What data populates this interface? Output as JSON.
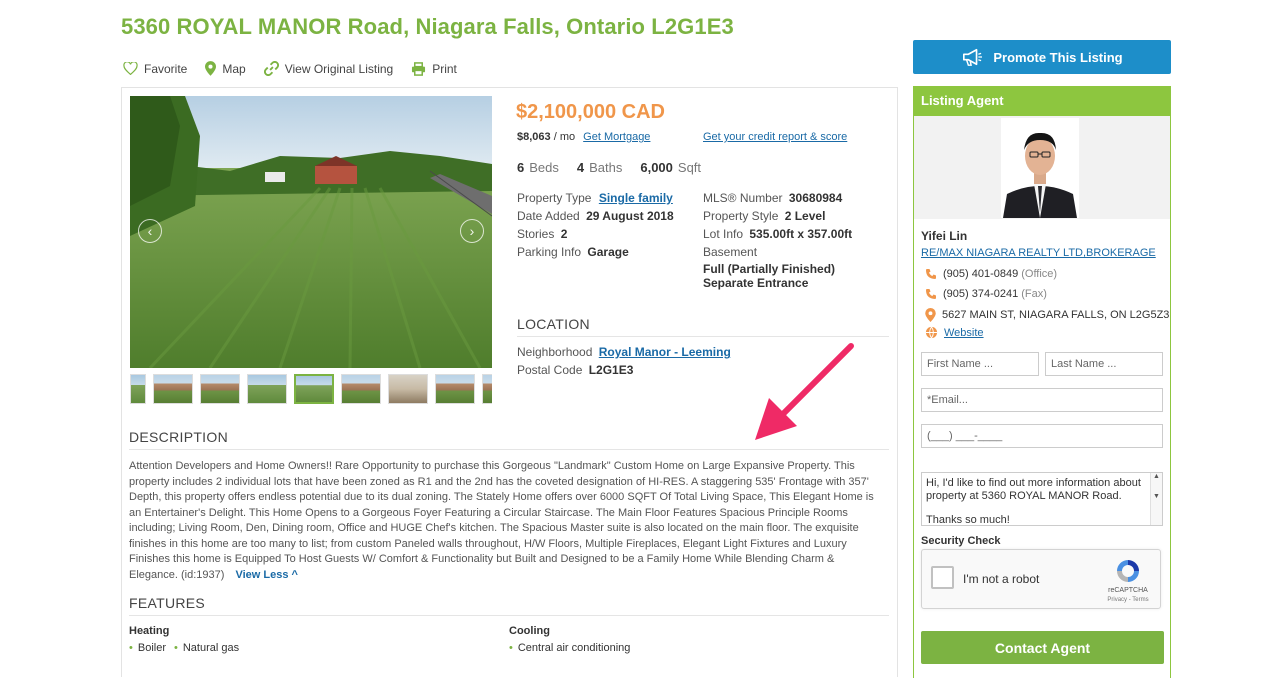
{
  "listing": {
    "title": "5360 ROYAL MANOR Road, Niagara Falls, Ontario L2G1E3"
  },
  "actions": {
    "favorite": "Favorite",
    "map": "Map",
    "view_original": "View Original Listing",
    "print": "Print"
  },
  "price": {
    "amount": "$2,100,000 CAD",
    "monthly": "$8,063",
    "per_mo": " / mo",
    "get_mortgage": "Get Mortgage",
    "credit_link": "Get your credit report & score"
  },
  "summary": {
    "beds_n": "6",
    "beds_label": "Beds",
    "baths_n": "4",
    "baths_label": "Baths",
    "sqft_n": "6,000",
    "sqft_label": "Sqft"
  },
  "details": {
    "property_type_label": "Property Type",
    "property_type": "Single family",
    "date_added_label": "Date Added",
    "date_added": "29 August 2018",
    "stories_label": "Stories",
    "stories": "2",
    "parking_label": "Parking Info",
    "parking": "Garage",
    "mls_label": "MLS® Number",
    "mls": "30680984",
    "style_label": "Property Style",
    "style": "2 Level",
    "lot_label": "Lot Info",
    "lot": "535.00ft x 357.00ft",
    "basement_label": "Basement",
    "basement": "Full (Partially Finished) Separate Entrance"
  },
  "location": {
    "heading": "LOCATION",
    "neighborhood_label": "Neighborhood",
    "neighborhood": "Royal Manor - Leeming",
    "postal_label": "Postal Code",
    "postal": "L2G1E3"
  },
  "description": {
    "heading": "DESCRIPTION",
    "text": "Attention Developers and Home Owners!! Rare Opportunity to purchase this Gorgeous \"Landmark\" Custom Home on Large Expansive Property. This property includes 2 individual lots that have been zoned as R1 and the 2nd has the coveted designation of HI-RES. A staggering 535' Frontage with 357' Depth, this property offers endless potential due to its dual zoning. The Stately Home offers over 6000 SQFT Of Total Living Space, This Elegant Home is an Entertainer's Delight. This Home Opens to a Gorgeous Foyer Featuring a Circular Staircase. The Main Floor Features Spacious Principle Rooms including; Living Room, Den, Dining room, Office and HUGE Chef's kitchen. The Spacious Master suite is also located on the main floor. The exquisite finishes in this home are too many to list; from custom Paneled walls throughout, H/W Floors, Multiple Fireplaces, Elegant Light Fixtures and Luxury Finishes this home is Equipped To Host Guests W/ Comfort & Functionality but Built and Designed to be a Family Home While Blending Charm & Elegance. (id:1937)",
    "view_less": "View Less ^"
  },
  "features": {
    "heading": "FEATURES",
    "heating_label": "Heating",
    "heating": [
      "Boiler",
      "Natural gas"
    ],
    "cooling_label": "Cooling",
    "cooling": [
      "Central air conditioning"
    ]
  },
  "sidebar": {
    "promote": "Promote This Listing",
    "agent_heading": "Listing Agent",
    "agent_name": "Yifei Lin",
    "brokerage": "RE/MAX NIAGARA REALTY LTD,BROKERAGE",
    "office_phone": "(905) 401-0849",
    "office_tag": "(Office)",
    "fax_phone": "(905) 374-0241",
    "fax_tag": "(Fax)",
    "address": "5627 MAIN ST, NIAGARA FALLS, ON L2G5Z3",
    "website": "Website"
  },
  "form": {
    "first_name": "First Name ...",
    "last_name": "Last Name ...",
    "email": "*Email...",
    "phone": "(___) ___-____",
    "message_1": "Hi, I'd like to find out more information about property at 5360 ROYAL MANOR Road.",
    "message_2": "Thanks so much!",
    "security_label": "Security Check",
    "recaptcha_label": "I'm not a robot",
    "recaptcha_brand": "reCAPTCHA",
    "recaptcha_terms": "Privacy - Terms",
    "contact_button": "Contact Agent"
  },
  "colors": {
    "brand_green": "#7cb342",
    "price_orange": "#f0964a",
    "link_blue": "#1a6aa6",
    "promote_blue": "#1d8ec9",
    "annotation_pink": "#ef2a66"
  }
}
